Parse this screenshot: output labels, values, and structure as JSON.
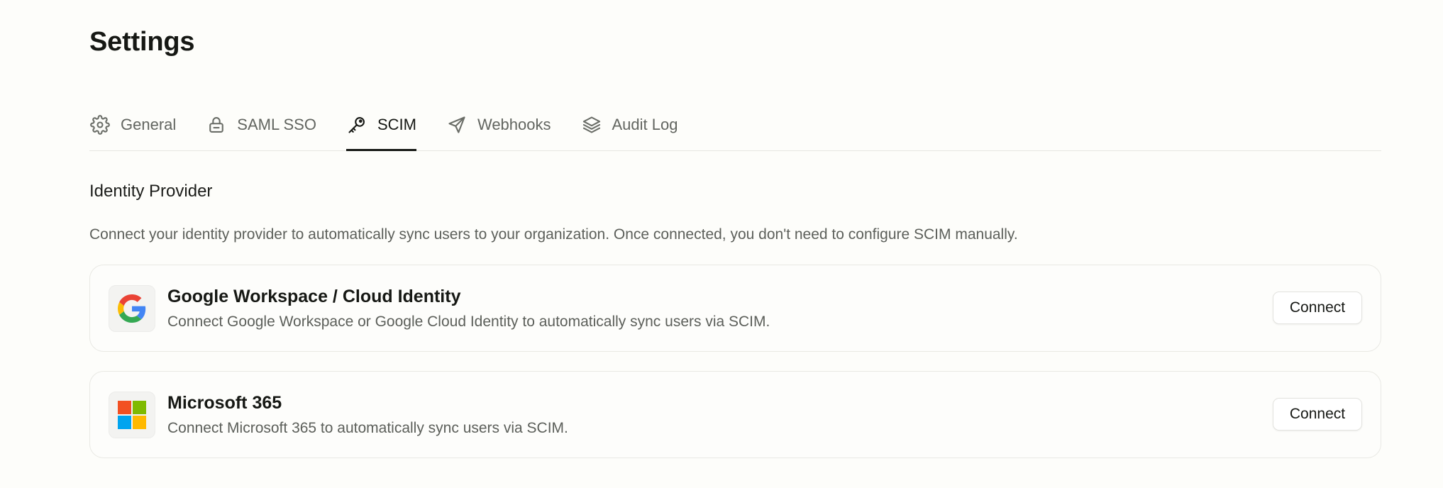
{
  "page": {
    "title": "Settings"
  },
  "tabs": [
    {
      "label": "General",
      "icon": "gear-icon",
      "active": false
    },
    {
      "label": "SAML SSO",
      "icon": "lock-icon",
      "active": false
    },
    {
      "label": "SCIM",
      "icon": "key-icon",
      "active": true
    },
    {
      "label": "Webhooks",
      "icon": "send-icon",
      "active": false
    },
    {
      "label": "Audit Log",
      "icon": "layers-icon",
      "active": false
    }
  ],
  "section": {
    "title": "Identity Provider",
    "description": "Connect your identity provider to automatically sync users to your organization. Once connected, you don't need to configure SCIM manually."
  },
  "providers": [
    {
      "name": "Google Workspace / Cloud Identity",
      "description": "Connect Google Workspace or Google Cloud Identity to automatically sync users via SCIM.",
      "icon": "google-logo-icon",
      "action_label": "Connect",
      "colors": {
        "blue": "#4285F4",
        "red": "#EA4335",
        "yellow": "#FBBC05",
        "green": "#34A853"
      }
    },
    {
      "name": "Microsoft 365",
      "description": "Connect Microsoft 365 to automatically sync users via SCIM.",
      "icon": "microsoft-logo-icon",
      "action_label": "Connect",
      "colors": {
        "red": "#F25022",
        "green": "#7FBA00",
        "blue": "#00A4EF",
        "yellow": "#FFB900"
      }
    }
  ]
}
